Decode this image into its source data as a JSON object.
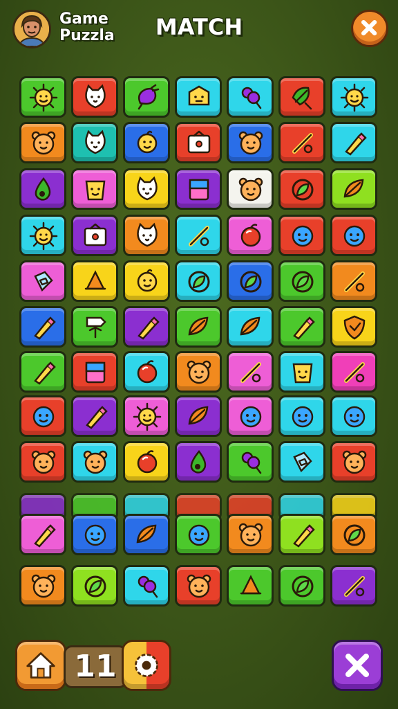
{
  "header": {
    "game_title_line1": "Game",
    "game_title_line2": "Puzzla",
    "match_title": "MATCH"
  },
  "footer": {
    "level_number": "11"
  },
  "colors": {
    "green": "#4cc82c",
    "red": "#e8402a",
    "orange": "#f28a1e",
    "cyan": "#2fd6ea",
    "purple": "#8b2fd0",
    "pink": "#ee5ed6",
    "yellow": "#f8d41a",
    "blue": "#2a6ee8",
    "lime": "#8fe020",
    "white": "#f4f4ee",
    "magenta": "#f03fb8",
    "teal": "#1ec0b0"
  },
  "board": {
    "rows": [
      [
        {
          "color": "green",
          "icon": "sun-face"
        },
        {
          "color": "red",
          "icon": "cat-face"
        },
        {
          "color": "green",
          "icon": "eggplant"
        },
        {
          "color": "cyan",
          "icon": "box-face"
        },
        {
          "color": "cyan",
          "icon": "grape-pop"
        },
        {
          "color": "red",
          "icon": "leaf-pop"
        },
        {
          "color": "cyan",
          "icon": "sun-face"
        }
      ],
      [
        {
          "color": "orange",
          "icon": "bear-face"
        },
        {
          "color": "teal",
          "icon": "cat-face"
        },
        {
          "color": "blue",
          "icon": "duck-face"
        },
        {
          "color": "red",
          "icon": "tv-box"
        },
        {
          "color": "blue",
          "icon": "bear-face"
        },
        {
          "color": "red",
          "icon": "stick"
        },
        {
          "color": "cyan",
          "icon": "pencil"
        }
      ],
      [
        {
          "color": "purple",
          "icon": "drop"
        },
        {
          "color": "pink",
          "icon": "cup-face"
        },
        {
          "color": "yellow",
          "icon": "cat-face"
        },
        {
          "color": "purple",
          "icon": "square-block"
        },
        {
          "color": "white",
          "icon": "bear-face"
        },
        {
          "color": "red",
          "icon": "leaf-ring"
        },
        {
          "color": "lime",
          "icon": "leaf"
        }
      ],
      [
        {
          "color": "cyan",
          "icon": "sun-face"
        },
        {
          "color": "purple",
          "icon": "tv-box"
        },
        {
          "color": "orange",
          "icon": "cat-face"
        },
        {
          "color": "cyan",
          "icon": "stick"
        },
        {
          "color": "pink",
          "icon": "ball"
        },
        {
          "color": "red",
          "icon": "ball-face"
        },
        {
          "color": "red",
          "icon": "ball-face"
        }
      ],
      [
        {
          "color": "pink",
          "icon": "note"
        },
        {
          "color": "yellow",
          "icon": "cone"
        },
        {
          "color": "yellow",
          "icon": "duck-face"
        },
        {
          "color": "cyan",
          "icon": "leaf-ring"
        },
        {
          "color": "blue",
          "icon": "leaf-ring"
        },
        {
          "color": "green",
          "icon": "leaf-ring"
        },
        {
          "color": "orange",
          "icon": "stick"
        }
      ],
      [
        {
          "color": "blue",
          "icon": "pencil"
        },
        {
          "color": "green",
          "icon": "sign"
        },
        {
          "color": "purple",
          "icon": "pencil"
        },
        {
          "color": "green",
          "icon": "leaf"
        },
        {
          "color": "cyan",
          "icon": "leaf"
        },
        {
          "color": "green",
          "icon": "pencil"
        },
        {
          "color": "yellow",
          "icon": "shield"
        }
      ],
      [
        {
          "color": "green",
          "icon": "pencil"
        },
        {
          "color": "red",
          "icon": "square-block"
        },
        {
          "color": "cyan",
          "icon": "ball"
        },
        {
          "color": "orange",
          "icon": "bear-face"
        },
        {
          "color": "pink",
          "icon": "stick"
        },
        {
          "color": "cyan",
          "icon": "cup-face"
        },
        {
          "color": "magenta",
          "icon": "stick"
        }
      ],
      [
        {
          "color": "red",
          "icon": "ball-face"
        },
        {
          "color": "purple",
          "icon": "pencil"
        },
        {
          "color": "pink",
          "icon": "sun-face"
        },
        {
          "color": "purple",
          "icon": "leaf"
        },
        {
          "color": "pink",
          "icon": "ball-face"
        },
        {
          "color": "cyan",
          "icon": "ball-face"
        },
        {
          "color": "cyan",
          "icon": "ball-face"
        }
      ],
      [
        {
          "color": "red",
          "icon": "bear-face"
        },
        {
          "color": "cyan",
          "icon": "bear-face"
        },
        {
          "color": "yellow",
          "icon": "ball"
        },
        {
          "color": "purple",
          "icon": "drop"
        },
        {
          "color": "green",
          "icon": "grape-pop"
        },
        {
          "color": "cyan",
          "icon": "note"
        },
        {
          "color": "red",
          "icon": "bear-face"
        }
      ],
      [
        {
          "color": "pink",
          "icon": "pencil"
        },
        {
          "color": "blue",
          "icon": "ball-face"
        },
        {
          "color": "blue",
          "icon": "leaf"
        },
        {
          "color": "green",
          "icon": "ball-face"
        },
        {
          "color": "orange",
          "icon": "bear-face"
        },
        {
          "color": "lime",
          "icon": "pencil"
        },
        {
          "color": "orange",
          "icon": "leaf-ring"
        }
      ],
      [
        {
          "color": "orange",
          "icon": "bear-face"
        },
        {
          "color": "lime",
          "icon": "leaf-ring"
        },
        {
          "color": "cyan",
          "icon": "grape-pop"
        },
        {
          "color": "red",
          "icon": "bear-face"
        },
        {
          "color": "green",
          "icon": "cone"
        },
        {
          "color": "green",
          "icon": "leaf-ring"
        },
        {
          "color": "purple",
          "icon": "stick"
        }
      ]
    ]
  }
}
